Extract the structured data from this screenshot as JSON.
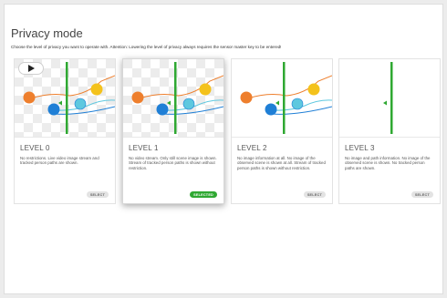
{
  "page": {
    "title": "Privacy mode",
    "subtitle": "Choose the level of privacy you want to operate with. Attention: Lowering the level of privacy always requires the sensor master key to be entered!"
  },
  "colors": {
    "accent_green": "#2fa832",
    "orange": "#ee7f2d",
    "yellow": "#f4c21b",
    "blue": "#1f7fd6",
    "cyan": "#5ec8df"
  },
  "cards": [
    {
      "level": "LEVEL 0",
      "description": "No restrictions. Live video image stream and tracked person paths are shown.",
      "button": "SELECT",
      "selected": false,
      "scene": "live-video-with-paths",
      "has_play_button": true
    },
    {
      "level": "LEVEL 1",
      "description": "No video stream. Only still scene image is shown. Stream of tracked person paths is shown without restriction.",
      "button": "SELECTED",
      "selected": true,
      "scene": "still-image-with-paths"
    },
    {
      "level": "LEVEL 2",
      "description": "No image information at all. No image of the observed scene is shown at all. Stream of tracked person paths is shown without restriction.",
      "button": "SELECT",
      "selected": false,
      "scene": "paths-only"
    },
    {
      "level": "LEVEL 3",
      "description": "No image and path information. No image of the observed scene is shown. No tracked person paths are shown.",
      "button": "SELECT",
      "selected": false,
      "scene": "nothing"
    }
  ]
}
